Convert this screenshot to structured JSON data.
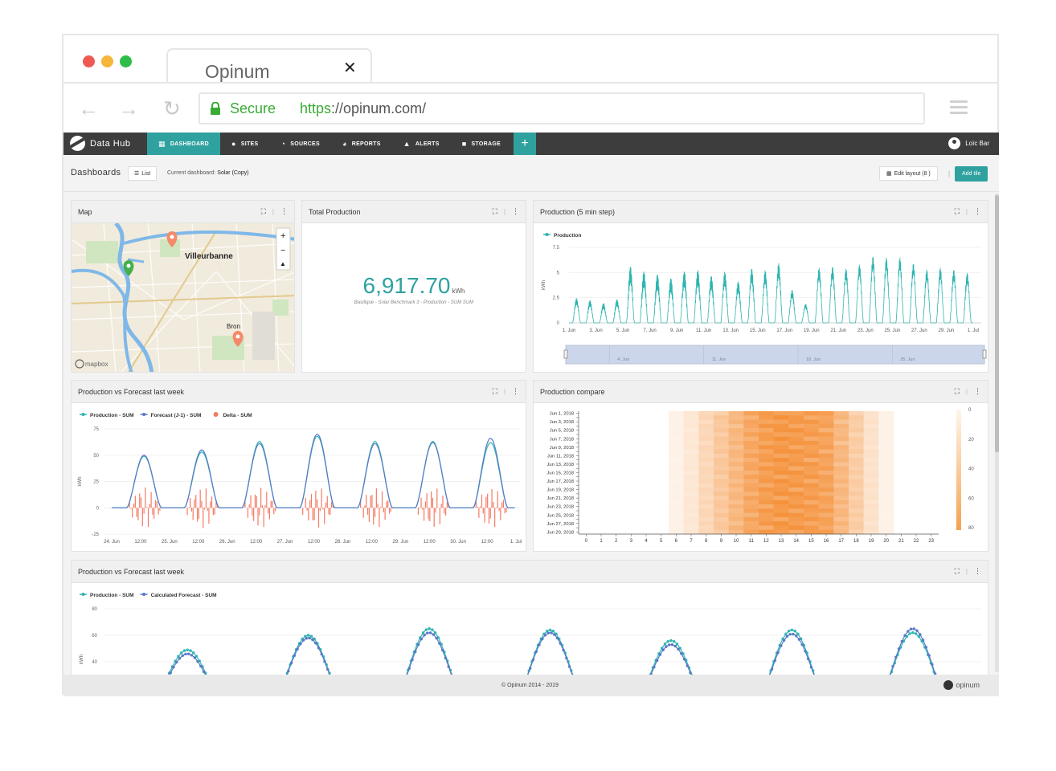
{
  "browser": {
    "tab_title": "Opinum",
    "secure_label": "Secure",
    "url_scheme": "https",
    "url_rest": "://opinum.com/",
    "dot_colors": [
      "#ee5a52",
      "#f5b73b",
      "#2ebd4a"
    ]
  },
  "nav": {
    "brand": "Data Hub",
    "items": [
      {
        "label": "DASHBOARD",
        "icon": "grid-icon"
      },
      {
        "label": "SITES",
        "icon": "pin-icon"
      },
      {
        "label": "SOURCES",
        "icon": "gauge-icon"
      },
      {
        "label": "REPORTS",
        "icon": "pie-icon"
      },
      {
        "label": "ALERTS",
        "icon": "bell-icon"
      },
      {
        "label": "STORAGE",
        "icon": "folder-icon"
      }
    ],
    "plus": "+",
    "user": "Loïc Bar",
    "accent": "#2fa2a0"
  },
  "subbar": {
    "title": "Dashboards",
    "list_label": "List",
    "current_label": "Current dashboard:",
    "current_value": "Solar (Copy)",
    "edit_layout": "Edit layout (8 )",
    "sep": "|",
    "add_tile": "Add tile"
  },
  "tiles": {
    "map": {
      "title": "Map",
      "labels": {
        "villeurbanne": "Villeurbanne",
        "bron": "Bron",
        "mapbox": "mapbox"
      }
    },
    "total": {
      "title": "Total Production",
      "value": "6,917.70",
      "unit": "kWh",
      "subtitle": "Basilique - Solar Benchmark 3 - Production - SUM SUM"
    },
    "prod5": {
      "title": "Production (5 min step)"
    },
    "forecast1": {
      "title": "Production vs Forecast last week"
    },
    "compare": {
      "title": "Production compare"
    },
    "forecast2": {
      "title": "Production vs Forecast last week"
    }
  },
  "footer": {
    "copyright": "© Opinum 2014 - 2019",
    "brand": "opinum"
  },
  "chart_data": [
    {
      "id": "prod5",
      "type": "line",
      "series": [
        {
          "name": "Production",
          "color": "#2fb5b1"
        }
      ],
      "x_ticks": [
        "1. Jun",
        "3. Jun",
        "5. Jun",
        "7. Jun",
        "9. Jun",
        "11. Jun",
        "13. Jun",
        "15. Jun",
        "17. Jun",
        "19. Jun",
        "21. Jun",
        "23. Jun",
        "25. Jun",
        "27. Jun",
        "29. Jun",
        "1. Jul"
      ],
      "y_ticks": [
        "0",
        "2.5",
        "5",
        "7.5"
      ],
      "ylabel": "kWh",
      "ylim": [
        0,
        7.5
      ],
      "daily_peaks": [
        2.5,
        2.3,
        2.0,
        2.4,
        5.8,
        5.3,
        5.0,
        4.6,
        5.3,
        5.4,
        4.8,
        5.2,
        4.2,
        5.5,
        5.3,
        6.0,
        3.3,
        1.9,
        5.5,
        5.6,
        5.4,
        5.8,
        6.6,
        6.5,
        6.5,
        5.9,
        5.3,
        5.5,
        5.3,
        5.0
      ],
      "navigator_ticks": [
        "4. Jun",
        "11. Jun",
        "18. Jun",
        "25. Jun"
      ]
    },
    {
      "id": "forecast1",
      "type": "line",
      "series": [
        {
          "name": "Production - SUM",
          "color": "#2fb5b1",
          "peaks": [
            49,
            53,
            63,
            68,
            63,
            63,
            62
          ]
        },
        {
          "name": "Forecast (J-1) - SUM",
          "color": "#5a78c7",
          "peaks": [
            50,
            55,
            61,
            70,
            61,
            62,
            66
          ]
        },
        {
          "name": "Delta - SUM",
          "color": "#f47a63",
          "type": "column"
        }
      ],
      "x_ticks": [
        "24. Jun",
        "12:00",
        "25. Jun",
        "12:00",
        "26. Jun",
        "12:00",
        "27. Jun",
        "12:00",
        "28. Jun",
        "12:00",
        "29. Jun",
        "12:00",
        "30. Jun",
        "12:00",
        "1. Jul"
      ],
      "y_ticks": [
        "-25",
        "0",
        "25",
        "50",
        "75"
      ],
      "ylabel": "kWh",
      "ylim": [
        -25,
        75
      ]
    },
    {
      "id": "compare",
      "type": "heatmap",
      "y_ticks": [
        "Jun 1, 2018",
        "Jun 3, 2018",
        "Jun 5, 2018",
        "Jun 7, 2018",
        "Jun 9, 2018",
        "Jun 11, 2018",
        "Jun 13, 2018",
        "Jun 15, 2018",
        "Jun 17, 2018",
        "Jun 19, 2018",
        "Jun 21, 2018",
        "Jun 23, 2018",
        "Jun 25, 2018",
        "Jun 27, 2018",
        "Jun 29, 2018"
      ],
      "x_ticks": [
        "0",
        "1",
        "2",
        "3",
        "4",
        "5",
        "6",
        "7",
        "8",
        "9",
        "10",
        "11",
        "12",
        "13",
        "14",
        "15",
        "16",
        "17",
        "18",
        "19",
        "20",
        "21",
        "22",
        "23"
      ],
      "color_ticks": [
        "0",
        "20",
        "40",
        "60",
        "80"
      ],
      "color_range": [
        0,
        80
      ],
      "hourly_profile": [
        0,
        0,
        0,
        0,
        0,
        0,
        0.05,
        0.15,
        0.3,
        0.45,
        0.6,
        0.75,
        0.85,
        0.9,
        0.88,
        0.85,
        0.8,
        0.6,
        0.4,
        0.2,
        0.05,
        0,
        0,
        0
      ]
    },
    {
      "id": "forecast2",
      "type": "line",
      "series": [
        {
          "name": "Production - SUM",
          "color": "#2fb5b1",
          "peaks": [
            49,
            60,
            65,
            64,
            56,
            64,
            62
          ]
        },
        {
          "name": "Calculated Forecast - SUM",
          "color": "#5a78c7",
          "peaks": [
            46,
            58,
            62,
            62,
            53,
            61,
            65
          ]
        }
      ],
      "y_ticks": [
        "40",
        "60",
        "80"
      ],
      "ylabel": "kWh"
    }
  ]
}
